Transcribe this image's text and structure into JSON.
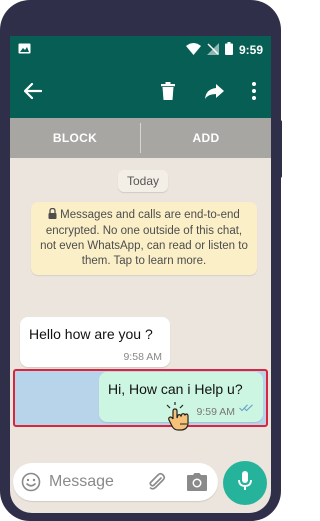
{
  "status_bar": {
    "time": "9:59"
  },
  "app_bar": {
    "back_icon": "arrow-left-icon",
    "delete_icon": "trash-icon",
    "forward_icon": "forward-arrow-icon",
    "menu_icon": "more-vert-icon"
  },
  "actions": {
    "block_label": "BLOCK",
    "add_label": "ADD"
  },
  "chat": {
    "date_label": "Today",
    "encryption_notice": "Messages and calls are end-to-end encrypted. No one outside of this chat, not even WhatsApp, can read or listen to them. Tap to learn more.",
    "messages": [
      {
        "direction": "incoming",
        "text": "Hello how are you ?",
        "time": "9:58 AM"
      },
      {
        "direction": "outgoing",
        "text": "Hi, How can i Help u?",
        "time": "9:59 AM",
        "status": "read"
      }
    ]
  },
  "composer": {
    "placeholder": "Message",
    "emoji_icon": "emoji-icon",
    "attach_icon": "paperclip-icon",
    "camera_icon": "camera-icon",
    "mic_icon": "microphone-icon"
  },
  "colors": {
    "header": "#075e54",
    "chat_bg": "#ece5dd",
    "outgoing_bubble": "#cdf6e2",
    "notice_bg": "#fbefc7",
    "selection_border": "#d7263d",
    "selection_fill": "#b8d4ea",
    "mic_button": "#25b39b"
  }
}
